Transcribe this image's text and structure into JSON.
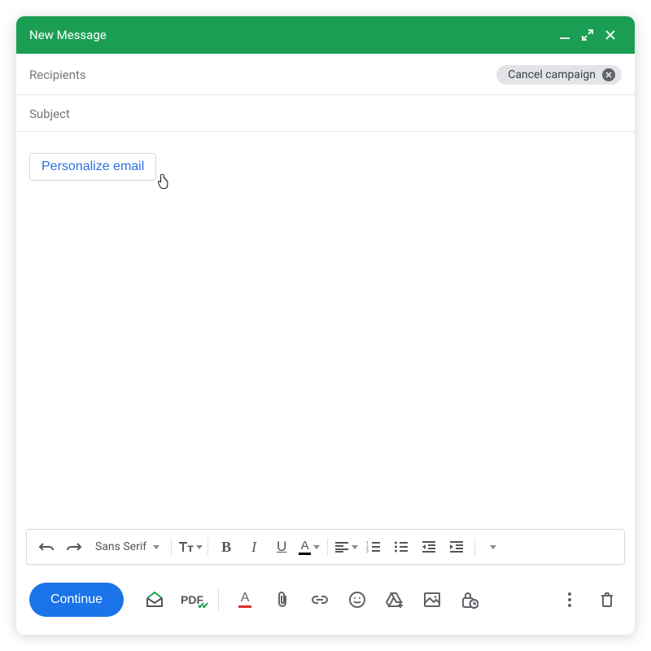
{
  "titlebar": {
    "title": "New Message"
  },
  "recipients": {
    "label": "Recipients",
    "chip": "Cancel campaign"
  },
  "subject": {
    "label": "Subject"
  },
  "body": {
    "personalize_label": "Personalize email"
  },
  "format_toolbar": {
    "font": "Sans Serif",
    "bold": "B",
    "italic": "I",
    "underline": "U"
  },
  "bottom": {
    "continue_label": "Continue",
    "pdf_label": "PDF"
  }
}
